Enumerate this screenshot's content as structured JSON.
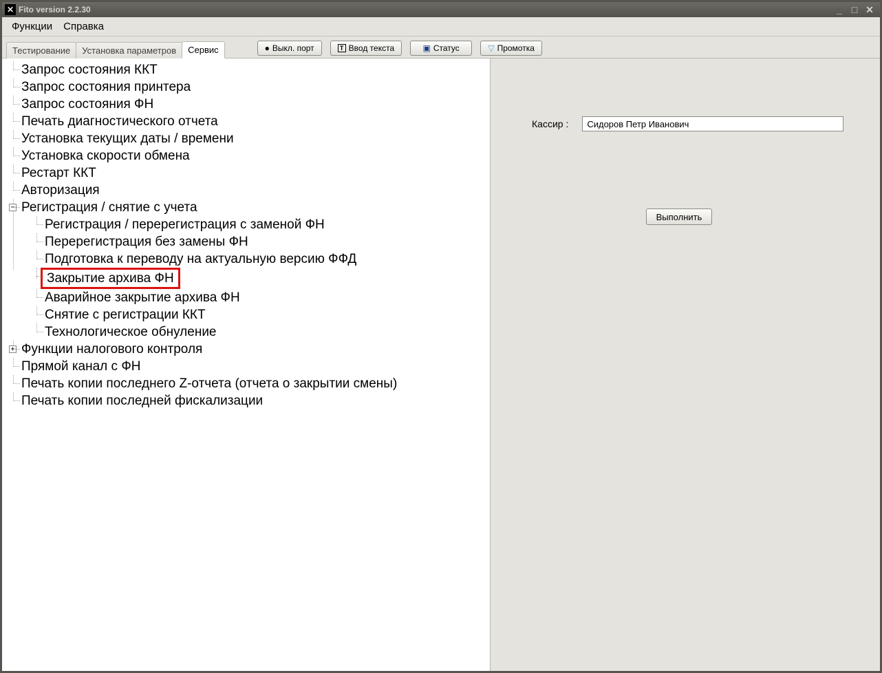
{
  "titlebar": {
    "title": "Fito version 2.2.30"
  },
  "menu": {
    "items": [
      "Функции",
      "Справка"
    ]
  },
  "tabs": {
    "items": [
      "Тестирование",
      "Установка параметров",
      "Сервис"
    ],
    "active_index": 2
  },
  "toolbar": {
    "buttons": [
      {
        "icon": "power-icon",
        "icon_color": "#c9a800",
        "glyph": "●",
        "label": "Выкл. порт"
      },
      {
        "icon": "text-icon",
        "icon_color": "#000",
        "glyph": "T",
        "label": "Ввод текста"
      },
      {
        "icon": "monitor-icon",
        "icon_color": "#1a3a8a",
        "glyph": "▣",
        "label": "Статус"
      },
      {
        "icon": "scroll-icon",
        "icon_color": "#4aa8e0",
        "glyph": "▽",
        "label": "Промотка"
      }
    ]
  },
  "tree": {
    "root": [
      {
        "label": "Запрос состояния ККТ"
      },
      {
        "label": "Запрос состояния принтера"
      },
      {
        "label": "Запрос состояния ФН"
      },
      {
        "label": "Печать диагностического отчета"
      },
      {
        "label": "Установка текущих даты / времени"
      },
      {
        "label": "Установка скорости обмена"
      },
      {
        "label": "Рестарт ККТ"
      },
      {
        "label": "Авторизация"
      },
      {
        "label": "Регистрация / снятие с учета",
        "expanded": true,
        "children": [
          {
            "label": "Регистрация / перерегистрация с заменой ФН"
          },
          {
            "label": "Перерегистрация без замены ФН"
          },
          {
            "label": "Подготовка к переводу на актуальную версию ФФД"
          },
          {
            "label": "Закрытие архива ФН",
            "highlight": true
          },
          {
            "label": "Аварийное закрытие архива ФН"
          },
          {
            "label": "Снятие с регистрации ККТ"
          },
          {
            "label": "Технологическое обнуление"
          }
        ]
      },
      {
        "label": "Функции налогового контроля",
        "expanded": false,
        "children": []
      },
      {
        "label": "Прямой канал с ФН"
      },
      {
        "label": "Печать копии последнего Z-отчета (отчета о закрытии смены)"
      },
      {
        "label": "Печать копии последней фискализации"
      }
    ]
  },
  "right_panel": {
    "field_label": "Кассир  :",
    "field_value": "Сидоров Петр Иванович",
    "execute_label": "Выполнить"
  }
}
